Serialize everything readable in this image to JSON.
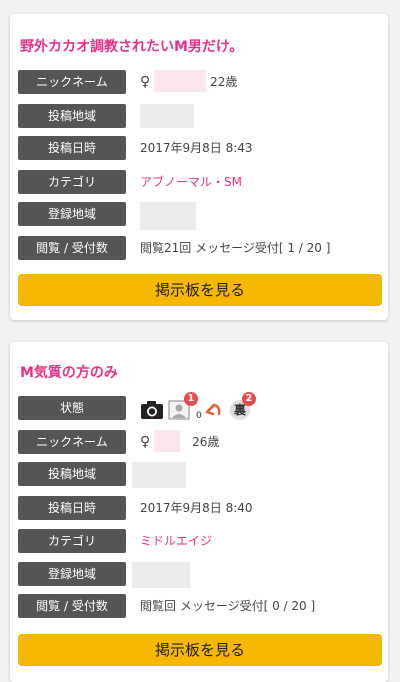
{
  "posts": [
    {
      "title": "野外カカオ調教されたいM男だけ。",
      "nickname_label": "ニックネーム",
      "gender_symbol": "♀",
      "age": "22歳",
      "region_label": "投稿地域",
      "date_label": "投稿日時",
      "date": "2017年9月8日 8:43",
      "category_label": "カテゴリ",
      "category": "アブノーマル・SM",
      "registered_label": "登録地域",
      "views_label": "閲覧 / 受付数",
      "views": "閲覧21回 メッセージ受付[ 1 / 20 ]",
      "button_label": "掲示板を見る"
    },
    {
      "title": "M気質の方のみ",
      "status_label": "状態",
      "status_icons": [
        "camera-icon",
        "profile-photo-icon",
        "reply-arrow-icon",
        "ura-icon"
      ],
      "badge_photo": "1",
      "reply_count": "0",
      "badge_ura": "2",
      "ura_char": "裏",
      "nickname_label": "ニックネーム",
      "gender_symbol": "♀",
      "age": "26歳",
      "region_label": "投稿地域",
      "date_label": "投稿日時",
      "date": "2017年9月8日 8:40",
      "category_label": "カテゴリ",
      "category": "ミドルエイジ",
      "registered_label": "登録地域",
      "views_label": "閲覧 / 受付数",
      "views": "閲覧回 メッセージ受付[ 0 / 20 ]",
      "button_label": "掲示板を見る"
    }
  ],
  "colors": {
    "accent": "#e4318a",
    "button": "#f5b800",
    "label_bg": "#555555"
  }
}
